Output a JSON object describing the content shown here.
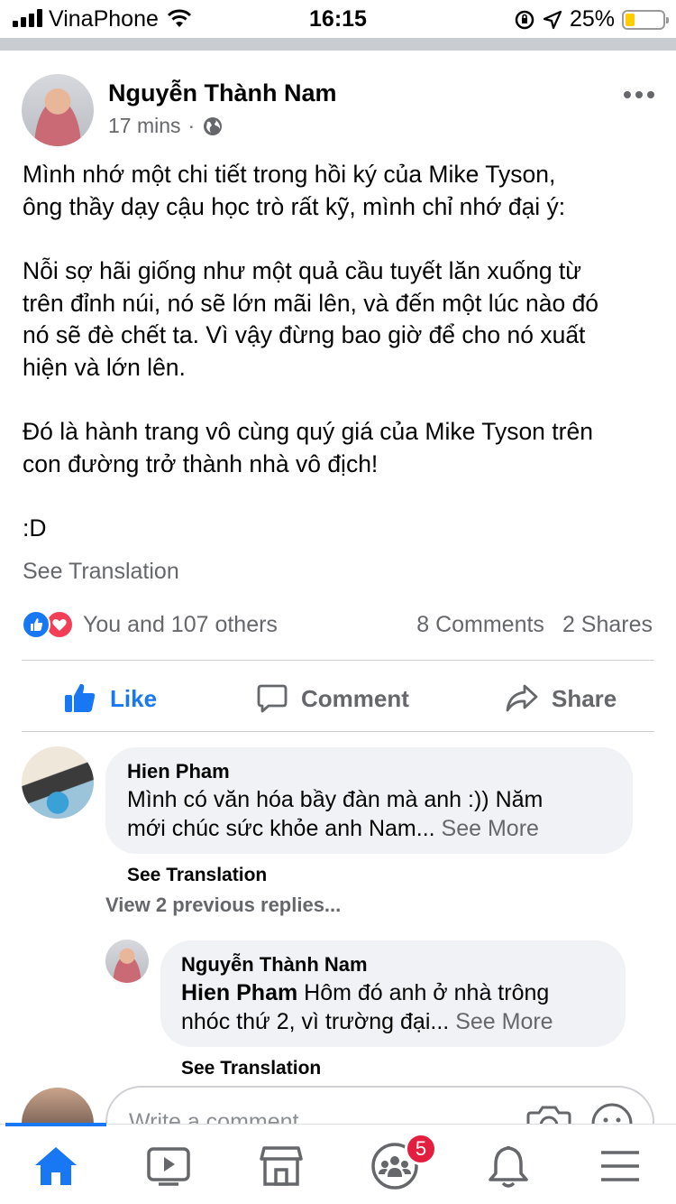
{
  "status_bar": {
    "carrier": "VinaPhone",
    "time": "16:15",
    "battery_percent": "25%",
    "battery_level": 0.25
  },
  "post": {
    "author": "Nguyễn Thành Nam",
    "time": "17 mins",
    "separator": "·",
    "privacy_icon": "globe-icon",
    "lines": [
      "Mình nhớ một chi tiết trong hồi ký của Mike Tyson,",
      "ông thầy dạy cậu học trò rất kỹ, mình chỉ nhớ đại ý:",
      "",
      "Nỗi sợ hãi giống như một quả cầu tuyết lăn xuống từ",
      "trên đỉnh núi, nó sẽ lớn mãi lên, và đến một lúc nào đó",
      "nó sẽ đè chết ta. Vì vậy đừng bao giờ để cho nó xuất",
      "hiện và lớn lên.",
      "",
      "Đó là hành trang vô cùng quý giá của Mike Tyson trên",
      "con đường trở thành nhà vô địch!",
      "",
      ":D"
    ],
    "see_translation": "See Translation",
    "reactions_text": "You and 107 others",
    "comments_count": "8 Comments",
    "shares_count": "2 Shares"
  },
  "actions": {
    "like": "Like",
    "comment": "Comment",
    "share": "Share"
  },
  "comments": [
    {
      "name": "Hien Pham",
      "line1": "Mình có văn hóa bầy đàn mà anh :)) Năm",
      "line2": "mới chúc sức khỏe anh Nam...",
      "see_more": "See More",
      "see_translation": "See Translation"
    }
  ],
  "view_replies": "View 2 previous replies...",
  "reply": {
    "name": "Nguyễn Thành Nam",
    "mention": "Hien Pham",
    "line1": "Hôm đó anh ở nhà trông",
    "line2": "nhóc thứ 2, vì trường đại...",
    "see_more": "See More",
    "see_translation": "See Translation"
  },
  "write_comment": {
    "placeholder": "Write a comment..."
  },
  "tab_bar": {
    "tabs": [
      "home-icon",
      "watch-icon",
      "marketplace-icon",
      "groups-icon",
      "notifications-icon",
      "menu-icon"
    ],
    "groups_badge": "5",
    "colors": {
      "active": "#1877f2",
      "badge": "#e41e3f"
    }
  }
}
